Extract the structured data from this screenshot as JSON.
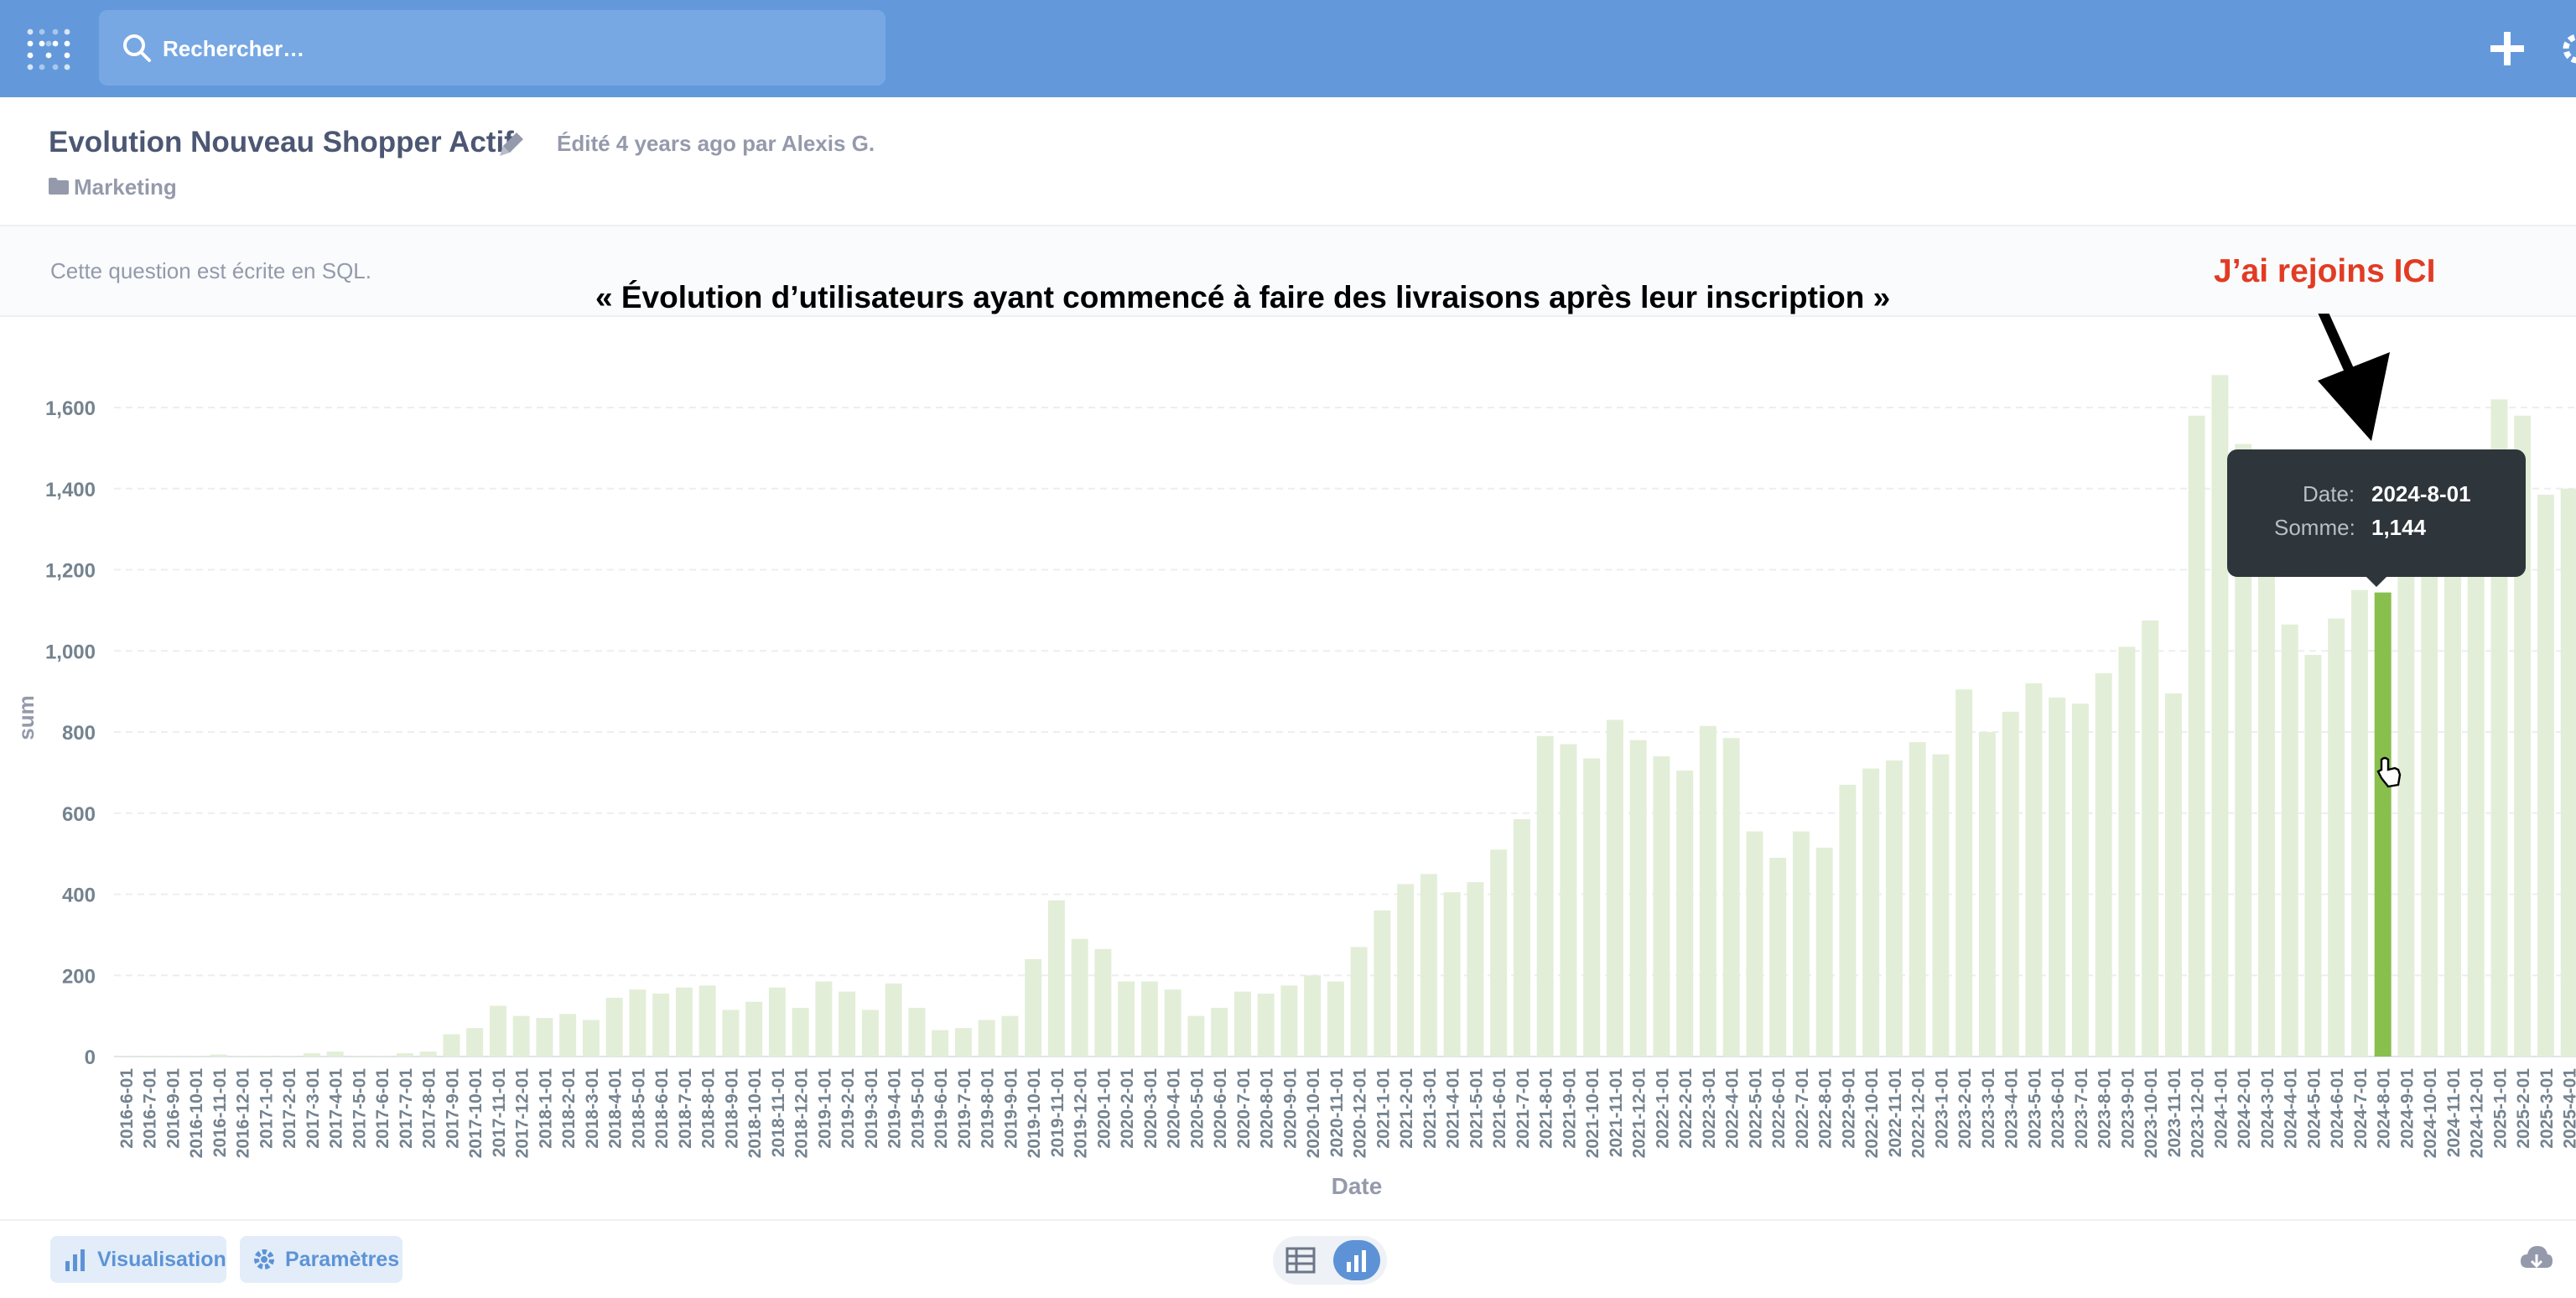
{
  "search": {
    "placeholder": "Rechercher…"
  },
  "header": {
    "title": "Evolution Nouveau Shopper Actif",
    "edited": "Édité 4 years ago par Alexis G.",
    "collection": "Marketing"
  },
  "sql_note": "Cette question est écrite en SQL.",
  "overlay_title": "« Évolution d’utilisateurs ayant commencé à faire des livraisons après leur inscription »",
  "annotation": {
    "label": "J’ai rejoins ICI",
    "color": "#e23b24"
  },
  "tooltip": {
    "date_key": "Date:",
    "date_value": "2024-8-01",
    "sum_key": "Somme:",
    "sum_value": "1,144"
  },
  "footer": {
    "visualisation": "Visualisation",
    "parametres": "Paramètres"
  },
  "colors": {
    "topbar": "#6399db",
    "bar": "#e3eed8",
    "bar_highlight": "#88bf4d",
    "accent": "#5d93d6"
  },
  "chart_data": {
    "type": "bar",
    "xlabel": "Date",
    "ylabel": "sum",
    "ylim": [
      0,
      1700
    ],
    "yticks": [
      0,
      200,
      400,
      600,
      800,
      1000,
      1200,
      1400,
      1600
    ],
    "ytick_labels": [
      "0",
      "200",
      "400",
      "600",
      "800",
      "1,000",
      "1,200",
      "1,400",
      "1,600"
    ],
    "grid": true,
    "highlighted_category": "2024-8-01",
    "categories": [
      "2016-6-01",
      "2016-7-01",
      "2016-9-01",
      "2016-10-01",
      "2016-11-01",
      "2016-12-01",
      "2017-1-01",
      "2017-2-01",
      "2017-3-01",
      "2017-4-01",
      "2017-5-01",
      "2017-6-01",
      "2017-7-01",
      "2017-8-01",
      "2017-9-01",
      "2017-10-01",
      "2017-11-01",
      "2017-12-01",
      "2018-1-01",
      "2018-2-01",
      "2018-3-01",
      "2018-4-01",
      "2018-5-01",
      "2018-6-01",
      "2018-7-01",
      "2018-8-01",
      "2018-9-01",
      "2018-10-01",
      "2018-11-01",
      "2018-12-01",
      "2019-1-01",
      "2019-2-01",
      "2019-3-01",
      "2019-4-01",
      "2019-5-01",
      "2019-6-01",
      "2019-7-01",
      "2019-8-01",
      "2019-9-01",
      "2019-10-01",
      "2019-11-01",
      "2019-12-01",
      "2020-1-01",
      "2020-2-01",
      "2020-3-01",
      "2020-4-01",
      "2020-5-01",
      "2020-6-01",
      "2020-7-01",
      "2020-8-01",
      "2020-9-01",
      "2020-10-01",
      "2020-11-01",
      "2020-12-01",
      "2021-1-01",
      "2021-2-01",
      "2021-3-01",
      "2021-4-01",
      "2021-5-01",
      "2021-6-01",
      "2021-7-01",
      "2021-8-01",
      "2021-9-01",
      "2021-10-01",
      "2021-11-01",
      "2021-12-01",
      "2022-1-01",
      "2022-2-01",
      "2022-3-01",
      "2022-4-01",
      "2022-5-01",
      "2022-6-01",
      "2022-7-01",
      "2022-8-01",
      "2022-9-01",
      "2022-10-01",
      "2022-11-01",
      "2022-12-01",
      "2023-1-01",
      "2023-2-01",
      "2023-3-01",
      "2023-4-01",
      "2023-5-01",
      "2023-6-01",
      "2023-7-01",
      "2023-8-01",
      "2023-9-01",
      "2023-10-01",
      "2023-11-01",
      "2023-12-01",
      "2024-1-01",
      "2024-2-01",
      "2024-3-01",
      "2024-4-01",
      "2024-5-01",
      "2024-6-01",
      "2024-7-01",
      "2024-8-01",
      "2024-9-01",
      "2024-10-01",
      "2024-11-01",
      "2024-12-01",
      "2025-1-01",
      "2025-2-01",
      "2025-3-01",
      "2025-4-01"
    ],
    "values": [
      1,
      1,
      2,
      2,
      5,
      2,
      2,
      2,
      8,
      12,
      2,
      2,
      8,
      12,
      55,
      70,
      125,
      100,
      95,
      105,
      90,
      145,
      165,
      155,
      170,
      175,
      115,
      135,
      170,
      120,
      185,
      160,
      115,
      180,
      120,
      65,
      70,
      90,
      100,
      240,
      385,
      290,
      265,
      185,
      185,
      165,
      100,
      120,
      160,
      155,
      175,
      200,
      185,
      270,
      360,
      425,
      450,
      405,
      430,
      510,
      585,
      790,
      770,
      735,
      830,
      780,
      740,
      705,
      815,
      785,
      555,
      490,
      555,
      515,
      670,
      710,
      730,
      775,
      745,
      905,
      800,
      850,
      920,
      885,
      870,
      945,
      1010,
      1075,
      895,
      1580,
      1680,
      1510,
      1400,
      1065,
      990,
      1080,
      1150,
      1144,
      1280,
      1300,
      1330,
      1350,
      1620,
      1580,
      1385,
      1400
    ]
  }
}
